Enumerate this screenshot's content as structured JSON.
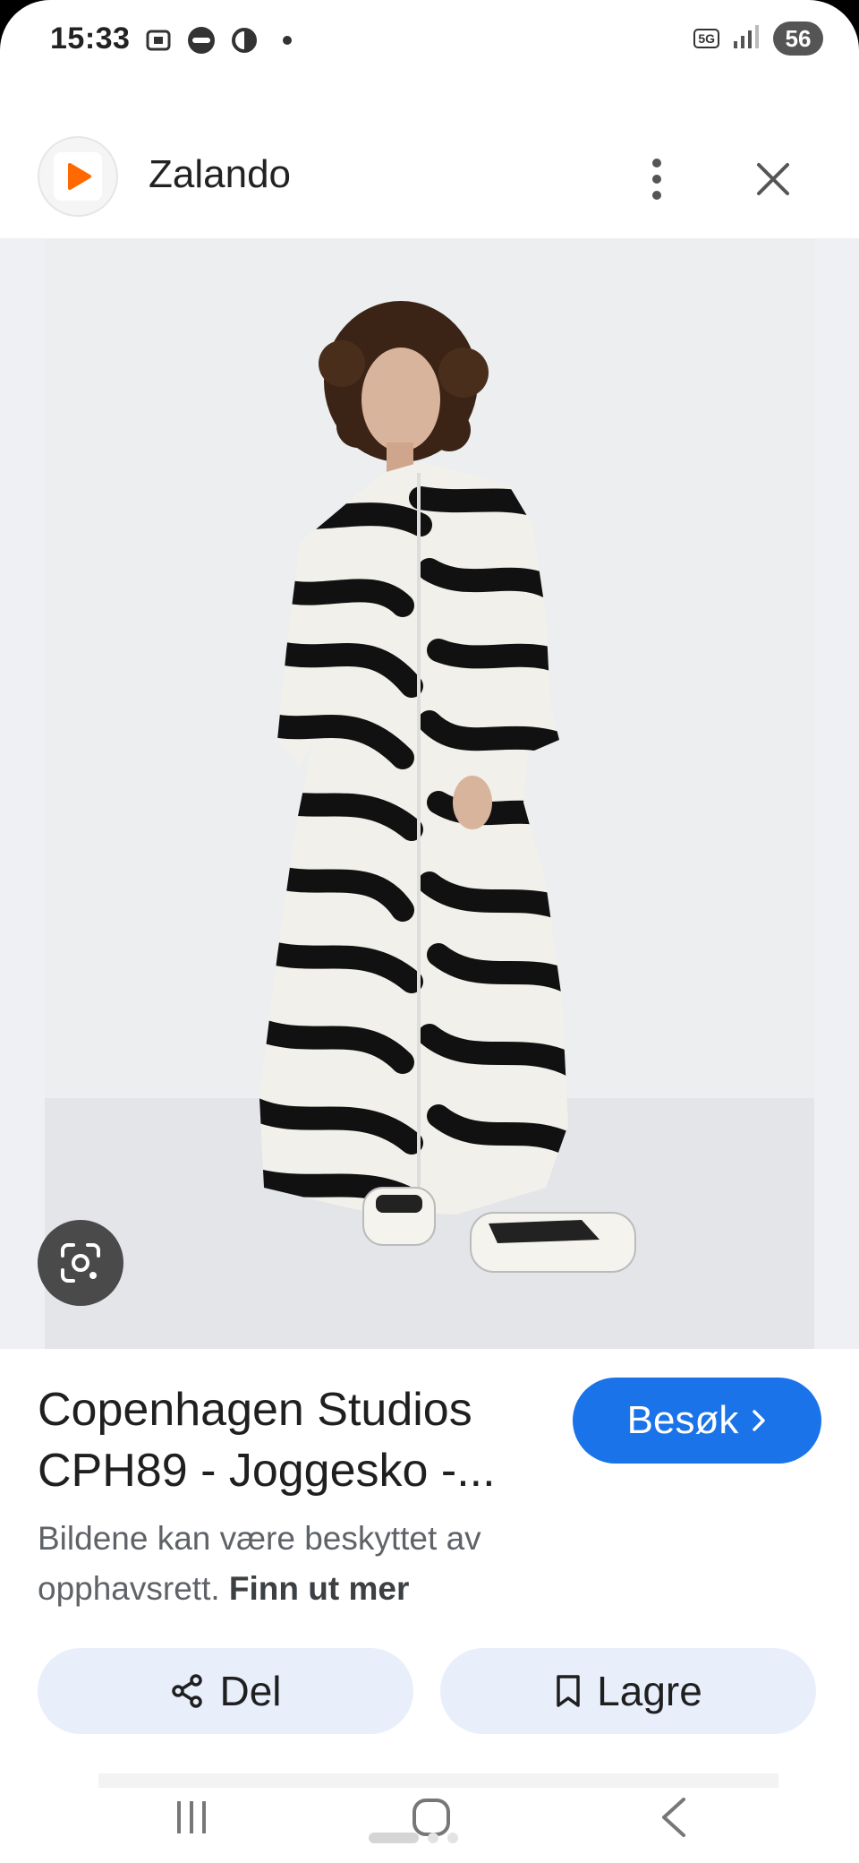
{
  "status_bar": {
    "time": "15:33",
    "network": "5G",
    "battery": "56",
    "left_icons": [
      "screenshot-icon",
      "coop-icon",
      "data-saver-icon",
      "dot-icon"
    ]
  },
  "top_bar": {
    "site_name": "Zalando",
    "logo_icon": "zalando-play-icon",
    "logo_color": "#ff6900"
  },
  "image": {
    "description_icon": "zebra-dress-photo",
    "lens_icon": "google-lens-icon"
  },
  "product": {
    "title_line1": "Copenhagen Studios",
    "title_line2": "CPH89 - Joggesko -...",
    "visit_label": "Besøk",
    "visit_color": "#1a73e8",
    "copyright_text": "Bildene kan være beskyttet av opphavsrett.",
    "learn_more": "Finn ut mer"
  },
  "actions": {
    "share_label": "Del",
    "save_label": "Lagre"
  },
  "nav_bar": {
    "icons": [
      "recent-apps-icon",
      "home-icon",
      "back-icon"
    ]
  }
}
